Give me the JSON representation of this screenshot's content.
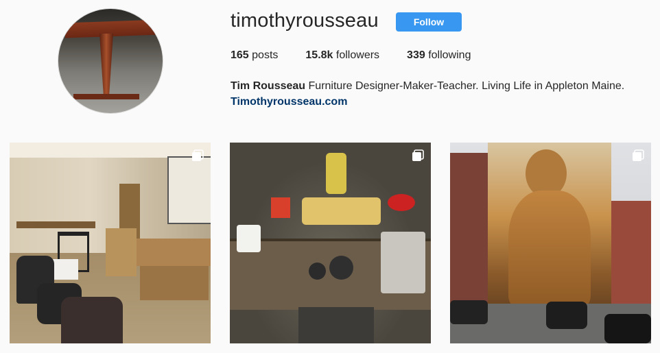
{
  "profile": {
    "username": "timothyrousseau",
    "follow_label": "Follow",
    "stats": {
      "posts_count": "165",
      "posts_label": "posts",
      "followers_count": "15.8k",
      "followers_label": "followers",
      "following_count": "339",
      "following_label": "following"
    },
    "bio": {
      "name": "Tim Rousseau",
      "text": "Furniture Designer-Maker-Teacher. Living Life in Appleton Maine.",
      "link": "Timothyrousseau.com"
    }
  },
  "colors": {
    "accent": "#3897f0",
    "link": "#003569",
    "background": "#fafafa"
  },
  "posts": [
    {
      "icon": "multiple-posts-icon"
    },
    {
      "icon": "multiple-posts-icon"
    },
    {
      "icon": "multiple-posts-icon"
    }
  ]
}
